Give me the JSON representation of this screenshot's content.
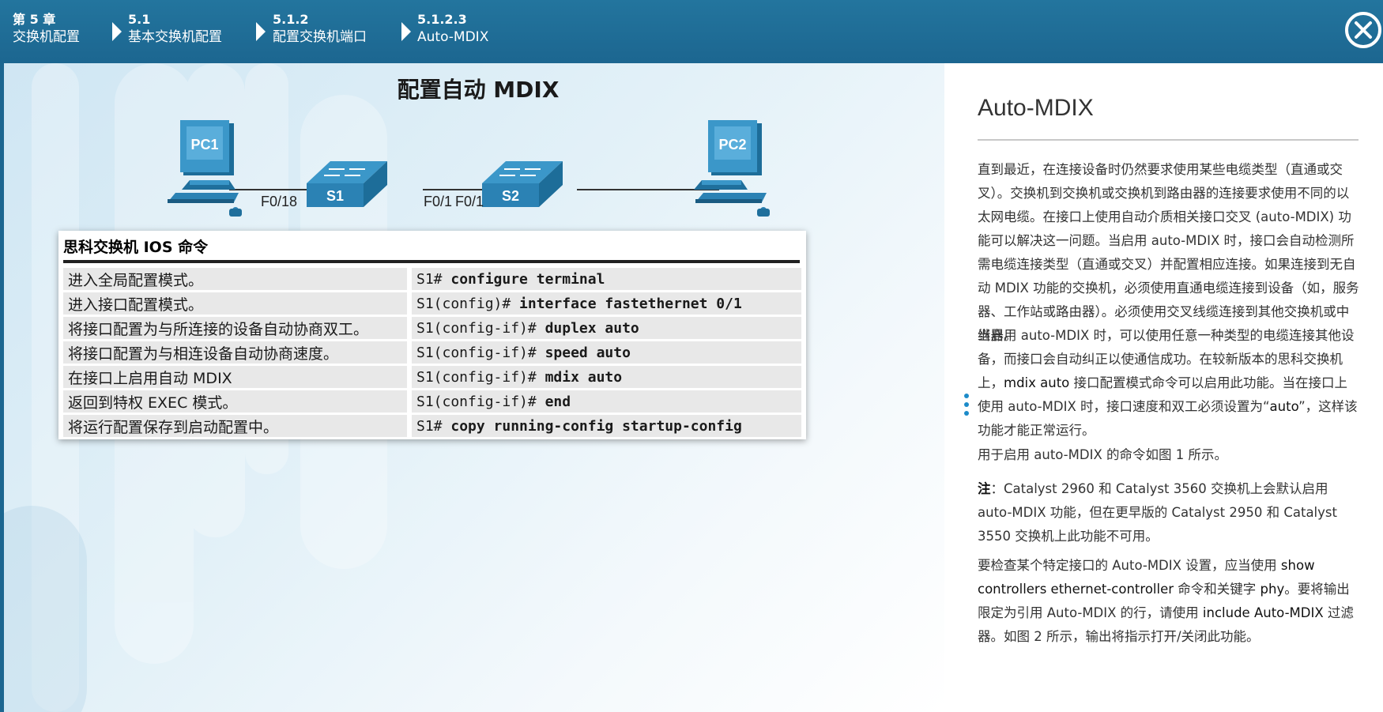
{
  "breadcrumb": [
    {
      "num": "第 5 章",
      "label": "交换机配置"
    },
    {
      "num": "5.1",
      "label": "基本交换机配置"
    },
    {
      "num": "5.1.2",
      "label": "配置交换机端口"
    },
    {
      "num": "5.1.2.3",
      "label": "Auto-MDIX"
    }
  ],
  "colors": {
    "header": "#1c6690",
    "accent": "#1c8bc9",
    "device_blue": "#2b82b4"
  },
  "figure": {
    "title": "配置自动 MDIX",
    "pc1": "PC1",
    "pc2": "PC2",
    "s1": "S1",
    "s2": "S2",
    "port_s1_pc": "F0/18",
    "port_s1_s2": "F0/1",
    "port_s2_s1": "F0/1"
  },
  "ios_table": {
    "title": "思科交换机 IOS 命令",
    "rows": [
      {
        "desc": "进入全局配置模式。",
        "prompt": "S1# ",
        "cmd": "configure terminal"
      },
      {
        "desc": "进入接口配置模式。",
        "prompt": "S1(config)# ",
        "cmd": "interface fastethernet 0/1"
      },
      {
        "desc": "将接口配置为与所连接的设备自动协商双工。",
        "prompt": "S1(config-if)# ",
        "cmd": "duplex auto"
      },
      {
        "desc": "将接口配置为与相连设备自动协商速度。",
        "prompt": "S1(config-if)# ",
        "cmd": "speed auto"
      },
      {
        "desc": "在接口上启用自动 MDIX",
        "prompt": "S1(config-if)# ",
        "cmd": "mdix auto"
      },
      {
        "desc": "返回到特权 EXEC 模式。",
        "prompt": "S1(config-if)# ",
        "cmd": "end"
      },
      {
        "desc": "将运行配置保存到启动配置中。",
        "prompt": "S1# ",
        "cmd": "copy running-config startup-config"
      }
    ]
  },
  "text_pane": {
    "title": "Auto-MDIX",
    "p1": "直到最近，在连接设备时仍然要求使用某些电缆类型（直通或交叉）。交换机到交换机或交换机到路由器的连接要求使用不同的以太网电缆。在接口上使用自动介质相关接口交叉 (auto-MDIX) 功能可以解决这一问题。当启用 auto-MDIX 时，接口会自动检测所需电缆连接类型（直通或交叉）并配置相应连接。如果连接到无自动 MDIX 功能的交换机，必须使用直通电缆连接到设备（如，服务器、工作站或路由器）。必须使用交叉线缆连接到其他交换机或中继器。",
    "p2_a": "当启用 auto-MDIX 时，可以使用任意一种类型的电缆连接其他设备，而接口会自动纠正以使通信成功。在较新版本的思科交换机上，",
    "p2_kw": "mdix auto",
    "p2_b": " 接口配置模式命令可以启用此功能。当在接口上使用 auto-MDIX 时，接口速度和双工必须设置为“",
    "p2_kw2": "auto",
    "p2_c": "”，这样该功能才能正常运行。",
    "p3": "用于启用 auto-MDIX 的命令如图 1 所示。",
    "p4_label": "注",
    "p4": "：Catalyst 2960 和 Catalyst 3560 交换机上会默认启用 auto-MDIX 功能，但在更早版的 Catalyst 2950 和 Catalyst 3550 交换机上此功能不可用。",
    "p5_a": "要检查某个特定接口的 Auto-MDIX 设置，应当使用 ",
    "p5_kw1": "show controllers ethernet-controller",
    "p5_b": " 命令和关键字 ",
    "p5_kw2": "phy",
    "p5_c": "。要将输出限定为引用 Auto-MDIX 的行，请使用 ",
    "p5_kw3": "include Auto-MDIX",
    "p5_d": " 过滤器。如图 2 所示，输出将指示打开/关闭此功能。"
  }
}
